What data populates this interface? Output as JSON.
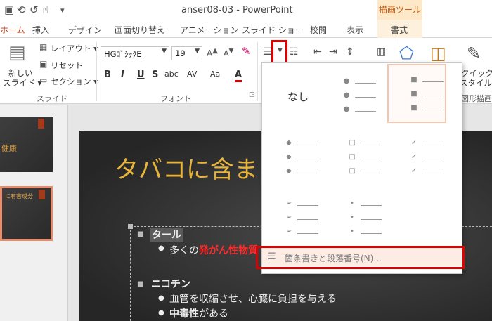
{
  "titlebar": {
    "title": "anser08-03 - PowerPoint",
    "context_group": "描画ツール",
    "undo_icon": "undo-icon",
    "redo_icon": "redo-icon",
    "touch_icon": "touch-mode-icon"
  },
  "tabs": [
    "ホーム",
    "挿入",
    "デザイン",
    "画面切り替え",
    "アニメーション",
    "スライド ショー",
    "校閲",
    "表示",
    "書式"
  ],
  "ribbon": {
    "slides_group": {
      "new_slide": "新しい",
      "new_slide_2": "スライド ▾",
      "layout": "レイアウト ▾",
      "reset": "リセット",
      "section": "セクション ▾",
      "label": "スライド"
    },
    "font_group": {
      "font_name": "HGｺﾞｼｯｸE",
      "font_size": "19",
      "bold": "B",
      "italic": "I",
      "underline": "U",
      "shadow": "S",
      "strike": "abc",
      "spacing": "AV",
      "case": "Aa",
      "color": "A",
      "label": "フォント",
      "accent_color": "#e00000"
    },
    "drawing_group": {
      "quick_style": "クイック",
      "quick_style_2": "スタイル ▾",
      "label": "図形描画"
    }
  },
  "gallery": {
    "none_label": "なし",
    "footer_label": "箇条書きと段落番号(N)..."
  },
  "thumbnails": {
    "slide1_text": "健康",
    "slide2_text": "に有害成分"
  },
  "slide": {
    "title": "タバコに含ま",
    "item1": "タール",
    "item1_sub_prefix": "多くの",
    "item1_sub_red": "発がん性物質",
    "item2": "ニコチン",
    "item2_sub1_a": "血管を収縮させ、",
    "item2_sub1_b": "心臓に負担",
    "item2_sub1_c": "を与える",
    "item2_sub2_a": "中毒性",
    "item2_sub2_b": "がある"
  },
  "colors": {
    "highlight_red": "#e00000",
    "title_gold": "#e8b43a",
    "home_tab": "#c43e1c"
  }
}
